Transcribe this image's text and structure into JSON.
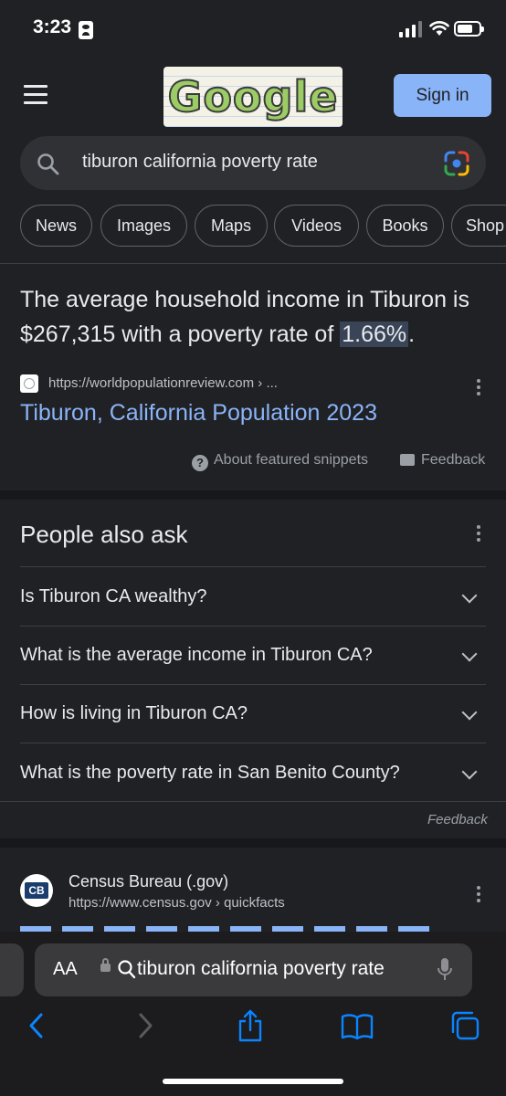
{
  "status": {
    "time": "3:23"
  },
  "header": {
    "logo_text": "Google",
    "sign_in": "Sign in"
  },
  "search": {
    "query": "tiburon california poverty rate"
  },
  "chips": [
    "News",
    "Images",
    "Maps",
    "Videos",
    "Books",
    "Shop"
  ],
  "snippet": {
    "text_before": "The average household income in Tiburon is $267,315 with a poverty rate of ",
    "highlight": "1.66%",
    "text_after": ".",
    "source_url": "https://worldpopulationreview.com › ...",
    "title": "Tiburon, California Population 2023",
    "about_label": "About featured snippets",
    "feedback_label": "Feedback"
  },
  "people_also_ask": {
    "title": "People also ask",
    "questions": [
      "Is Tiburon CA wealthy?",
      "What is the average income in Tiburon CA?",
      "How is living in Tiburon CA?",
      "What is the poverty rate in San Benito County?"
    ],
    "feedback_label": "Feedback"
  },
  "next_result": {
    "logo_text": "CB",
    "site_name": "Census Bureau (.gov)",
    "url": "https://www.census.gov › quickfacts"
  },
  "browser": {
    "aa_label": "AA",
    "address_text": "tiburon california poverty rate"
  },
  "colors": {
    "background": "#202124",
    "link": "#8ab4f8",
    "button": "#8ab4f8"
  }
}
